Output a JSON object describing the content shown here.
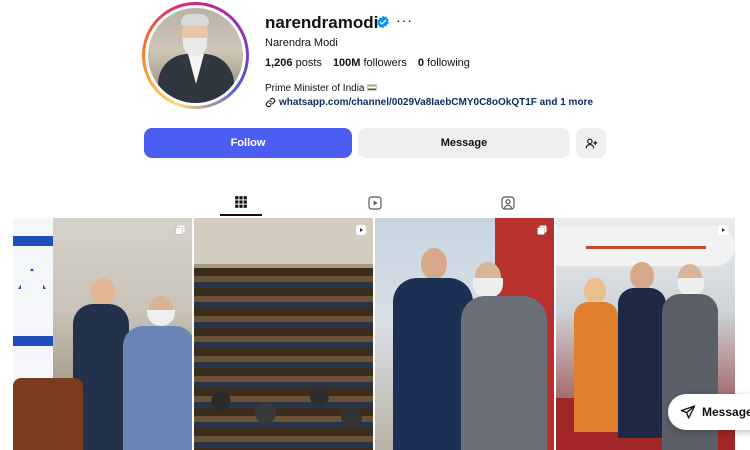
{
  "profile": {
    "username": "narendramodi",
    "full_name": "Narendra Modi",
    "more_label": "···",
    "stats": {
      "posts_count": "1,206",
      "posts_label": "posts",
      "followers_count": "100M",
      "followers_label": "followers",
      "following_count": "0",
      "following_label": "following"
    },
    "bio": "Prime Minister of India",
    "link_main": "whatsapp.com/channel/0029Va8IaebCMY0C8oOkQT1F",
    "link_more": "and 1 more"
  },
  "actions": {
    "follow_label": "Follow",
    "message_label": "Message"
  },
  "tabs": [
    {
      "icon": "grid-icon",
      "active": true
    },
    {
      "icon": "reels-icon",
      "active": false
    },
    {
      "icon": "tagged-icon",
      "active": false
    }
  ],
  "posts": [
    {
      "type": "carousel",
      "icon": "carousel-icon"
    },
    {
      "type": "video",
      "icon": "reel-icon"
    },
    {
      "type": "carousel",
      "icon": "carousel-icon"
    },
    {
      "type": "video",
      "icon": "reel-icon"
    }
  ],
  "floating": {
    "message_label": "Message"
  },
  "colors": {
    "follow_button": "#4a5ef2",
    "secondary_button": "#efefef",
    "verified": "#0095f6"
  }
}
